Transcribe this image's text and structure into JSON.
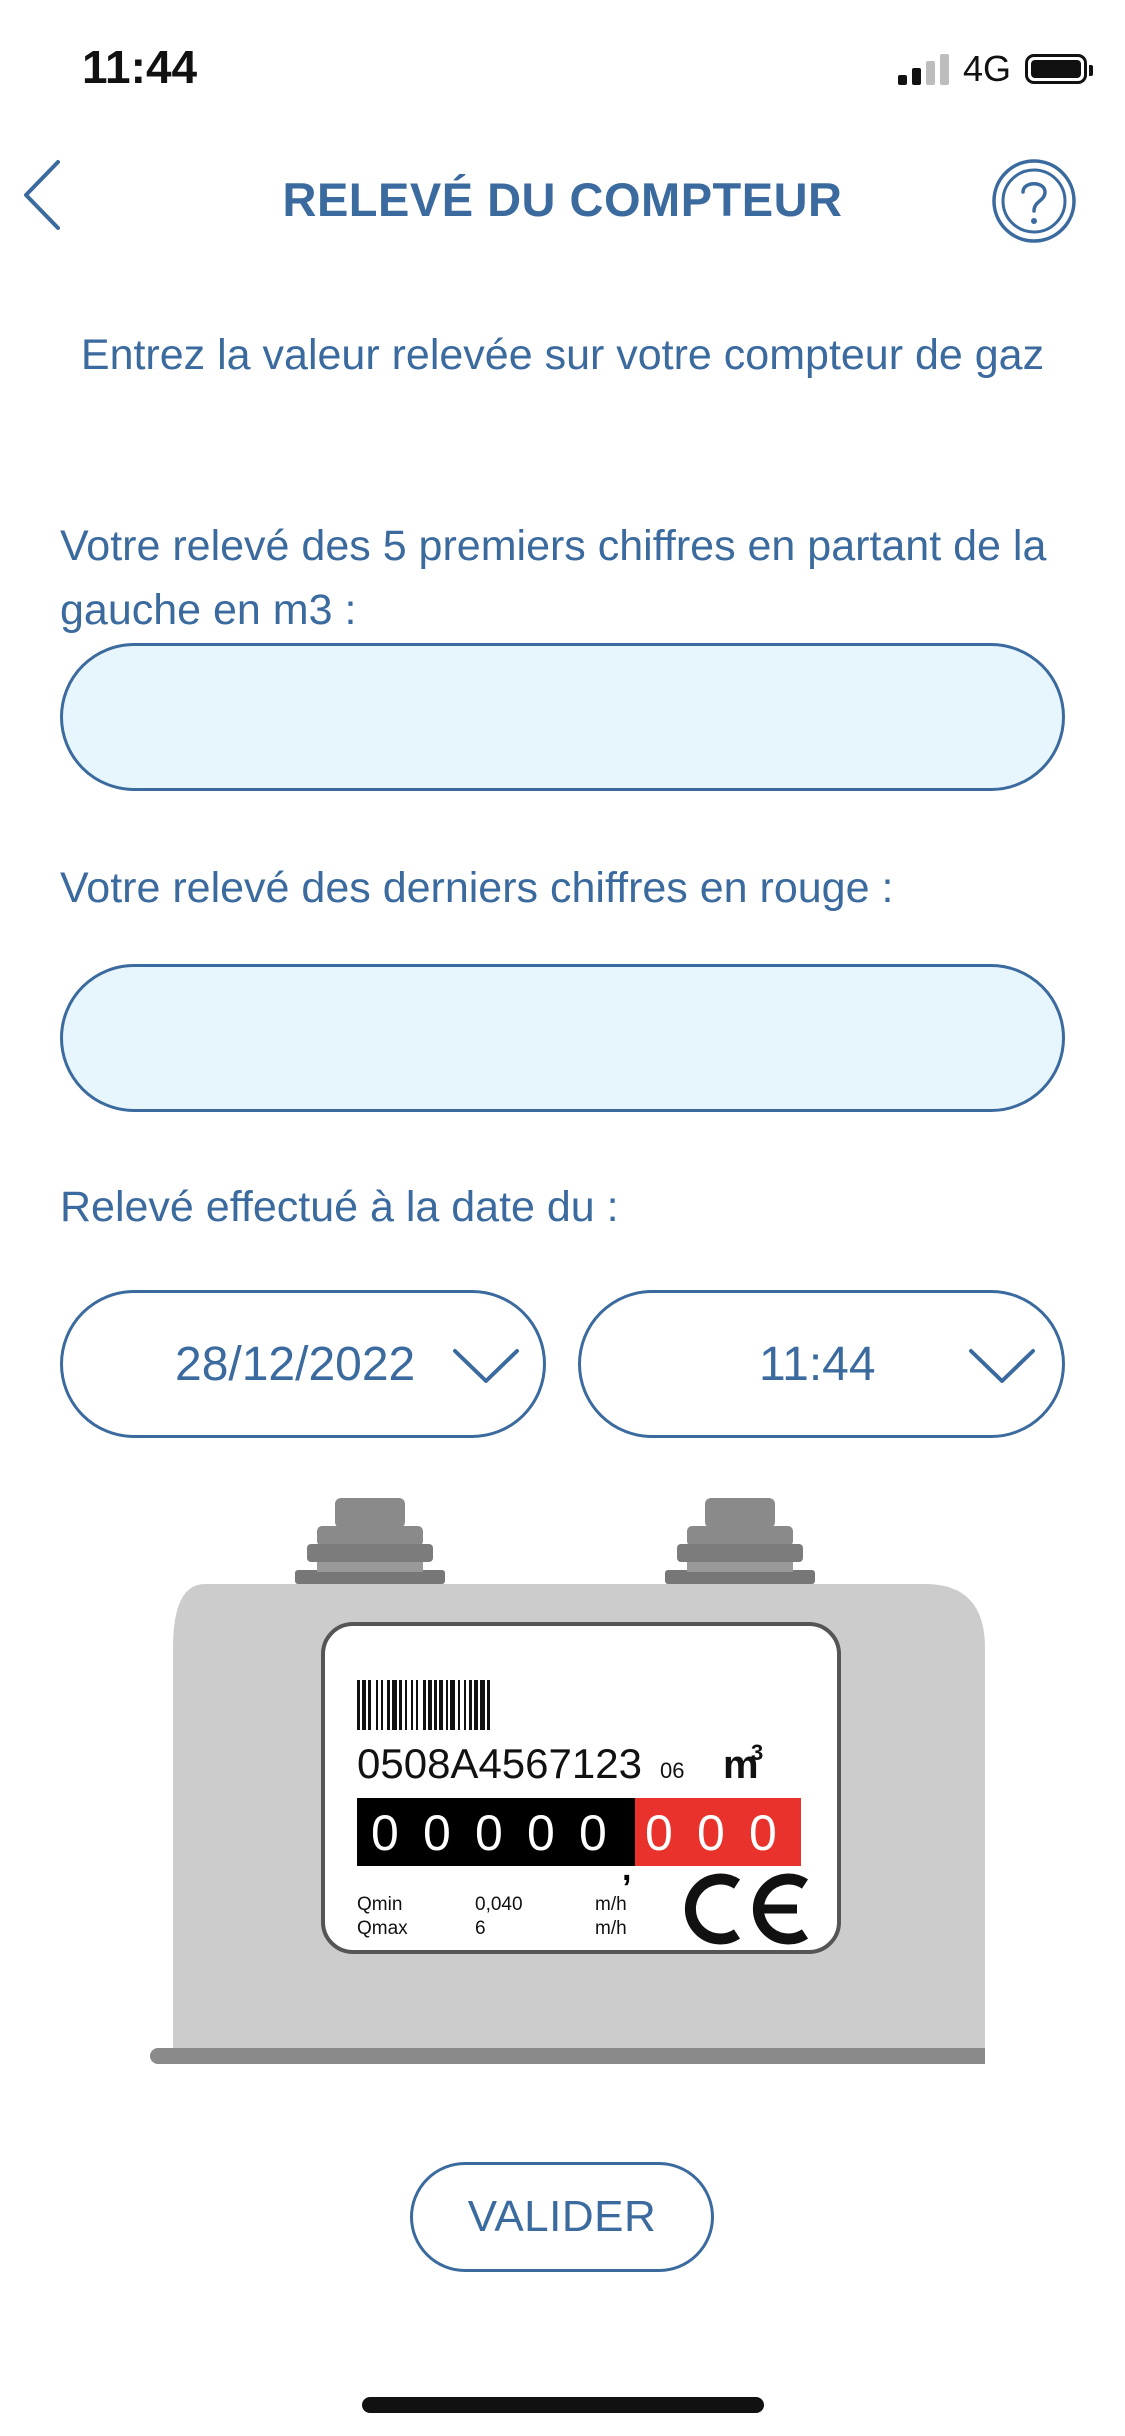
{
  "status_bar": {
    "time": "11:44",
    "network": "4G",
    "signal_bars_active": 2,
    "signal_bars_total": 4,
    "battery_level": 1.0
  },
  "header": {
    "title": "RELEVÉ DU COMPTEUR",
    "back_icon": "chevron-left-icon",
    "help_icon": "question-circle-icon"
  },
  "form": {
    "instruction": "Entrez la valeur relevée sur votre compteur de gaz",
    "first_digits_label": "Votre relevé des 5 premiers chiffres en partant de la gauche en m3 :",
    "first_digits_value": "",
    "last_digits_label": "Votre relevé des derniers chiffres en rouge :",
    "last_digits_value": "",
    "date_label": "Relevé effectué à la date du :",
    "date_value": "28/12/2022",
    "time_value": "11:44",
    "submit_label": "VALIDER"
  },
  "meter": {
    "serial": "0508A4567123",
    "serial_suffix": "06",
    "unit": "m",
    "unit_exp": "3",
    "black_digits": [
      "0",
      "0",
      "0",
      "0",
      "0"
    ],
    "comma": ",",
    "red_digits": [
      "0",
      "0",
      "0"
    ],
    "qmin_label": "Qmin",
    "qmin_value": "0,040",
    "qmin_unit": "m/h",
    "qmax_label": "Qmax",
    "qmax_value": "6",
    "qmax_unit": "m/h",
    "mark": "CE"
  },
  "colors": {
    "accent": "#3b6a9e",
    "input_background": "#e7f6fd",
    "meter_body": "#cccccc",
    "meter_red": "#e8322b"
  }
}
